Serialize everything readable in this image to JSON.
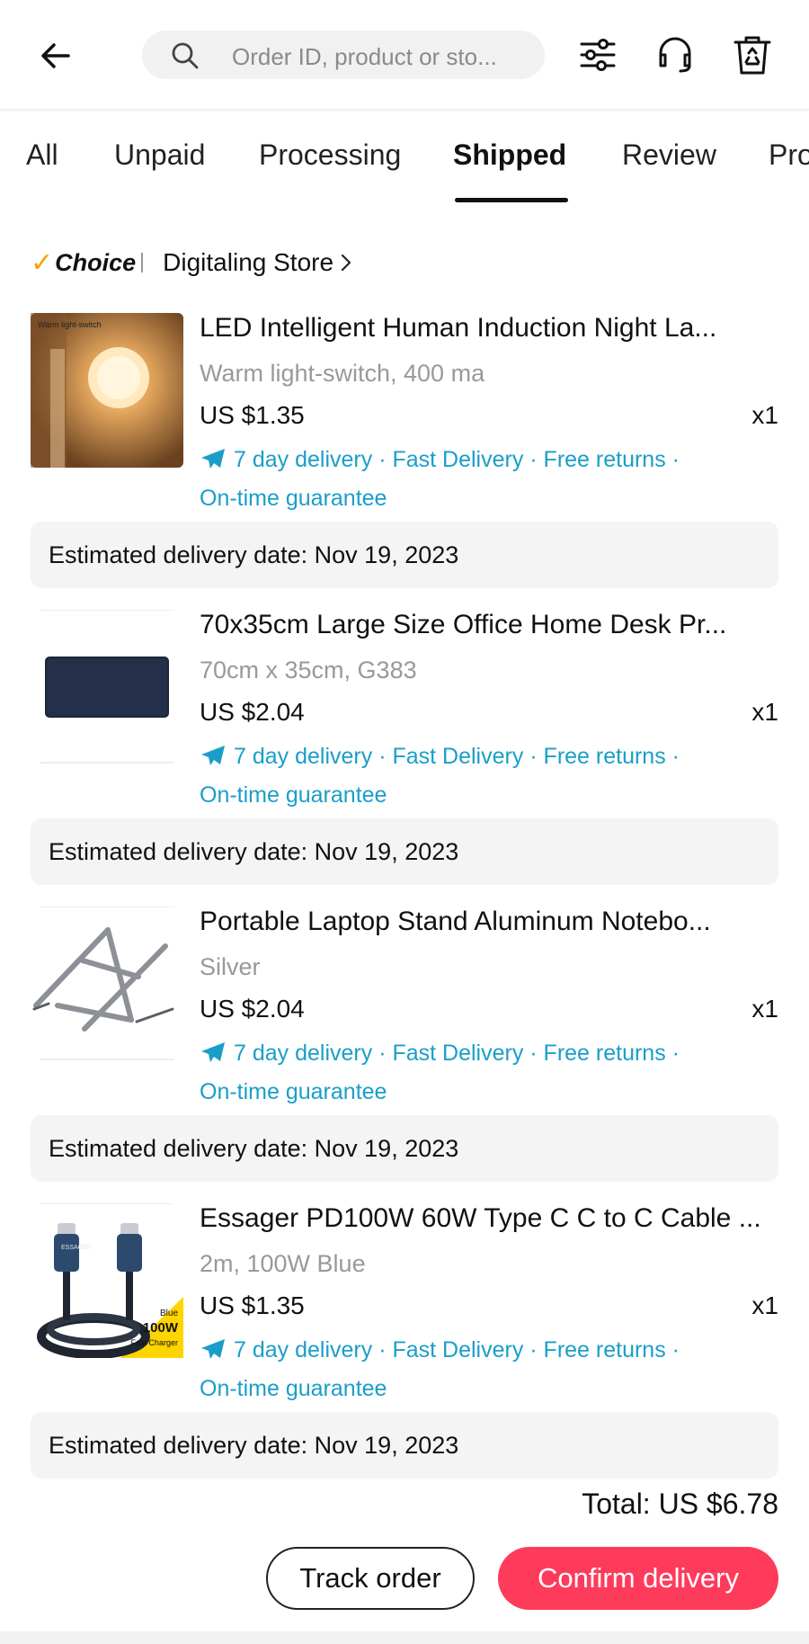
{
  "header": {
    "search_placeholder": "Order ID, product or sto...",
    "icons": [
      "back-arrow-icon",
      "search-icon",
      "filter-icon",
      "headset-icon",
      "recycle-bin-icon"
    ]
  },
  "tabs": [
    {
      "label": "All"
    },
    {
      "label": "Unpaid"
    },
    {
      "label": "Processing"
    },
    {
      "label": "Shipped",
      "active": true
    },
    {
      "label": "Review"
    },
    {
      "label": "Pro"
    }
  ],
  "store": {
    "badge": "Choice",
    "name": "Digitaling Store"
  },
  "items": [
    {
      "title": "LED Intelligent Human Induction Night La...",
      "variant": "Warm light-switch, 400 ma",
      "price": "US $1.35",
      "qty": "x1",
      "thumb_caption": "Warm light-switch",
      "perks_line1": "7 day delivery · Fast Delivery · Free returns ·",
      "perks_line2": "On-time guarantee",
      "estimated": "Estimated delivery date: Nov 19, 2023"
    },
    {
      "title": "70x35cm Large Size Office Home Desk Pr...",
      "variant": "70cm x 35cm, G383",
      "price": "US $2.04",
      "qty": "x1",
      "perks_line1": "7 day delivery · Fast Delivery · Free returns ·",
      "perks_line2": "On-time guarantee",
      "estimated": "Estimated delivery date: Nov 19, 2023"
    },
    {
      "title": "Portable Laptop Stand Aluminum Notebo...",
      "variant": "Silver",
      "price": "US $2.04",
      "qty": "x1",
      "perks_line1": "7 day delivery · Fast Delivery · Free returns ·",
      "perks_line2": "On-time guarantee",
      "estimated": "Estimated delivery date: Nov 19, 2023"
    },
    {
      "title": "Essager PD100W 60W Type C C to C Cable ...",
      "variant": "2m, 100W Blue",
      "price": "US $1.35",
      "qty": "x1",
      "thumb_badge_top": "Blue",
      "thumb_badge_main": "100W",
      "thumb_badge_sub": "Fast Charger",
      "thumb_brand": "ESSAGER",
      "perks_line1": "7 day delivery · Fast Delivery · Free returns ·",
      "perks_line2": "On-time guarantee",
      "estimated": "Estimated delivery date: Nov 19, 2023"
    }
  ],
  "total": "Total: US $6.78",
  "buttons": {
    "track": "Track order",
    "confirm": "Confirm delivery"
  },
  "colors": {
    "accent": "#ff3b5c",
    "link": "#1a9ec9",
    "choice_check": "#f5a300"
  }
}
